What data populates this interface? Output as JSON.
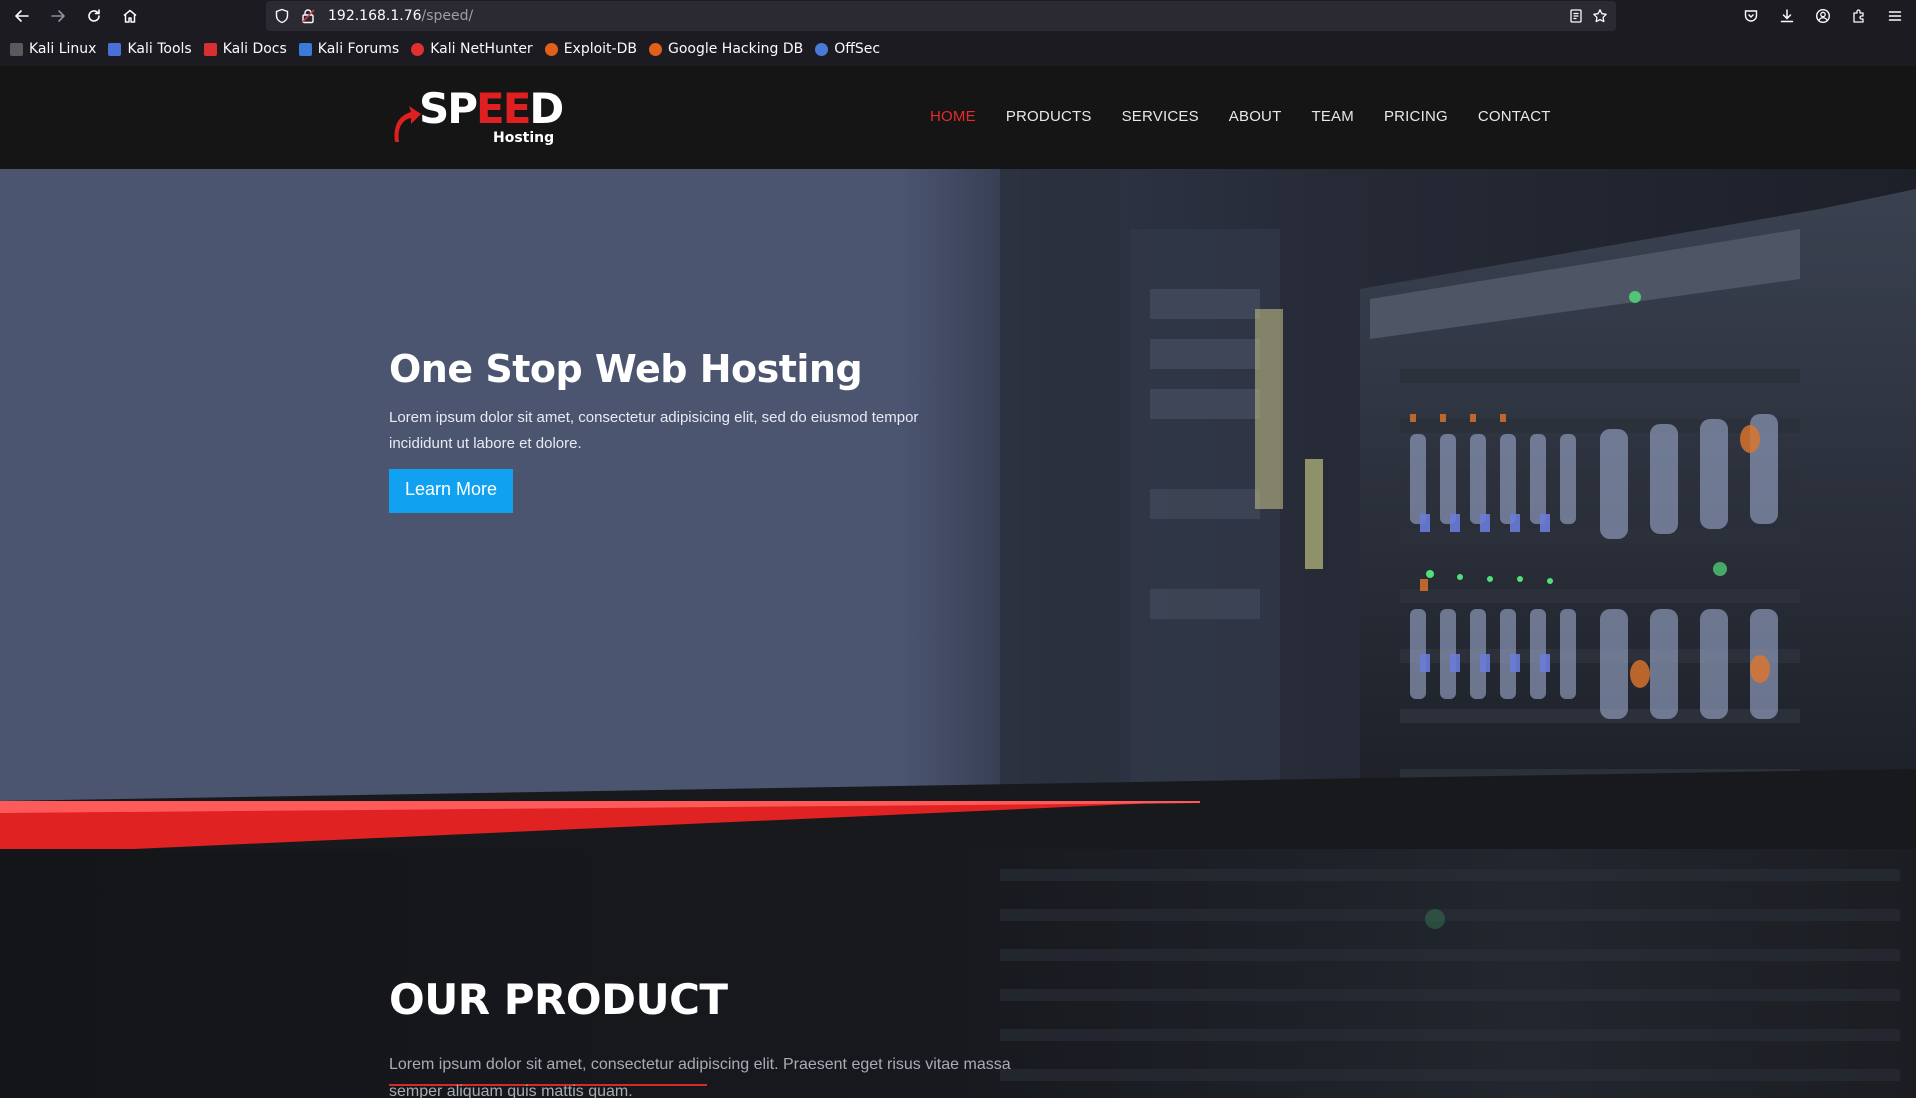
{
  "browser": {
    "url_host": "192.168.1.76",
    "url_path": "/speed/",
    "bookmarks": [
      {
        "label": "Kali Linux",
        "icon": "kali-linux-icon",
        "color": "#6e6e6e"
      },
      {
        "label": "Kali Tools",
        "icon": "kali-tools-icon",
        "color": "#4a6fd8"
      },
      {
        "label": "Kali Docs",
        "icon": "kali-docs-icon",
        "color": "#d83030"
      },
      {
        "label": "Kali Forums",
        "icon": "kali-forums-icon",
        "color": "#3a7ad8"
      },
      {
        "label": "Kali NetHunter",
        "icon": "kali-nethunter-icon",
        "color": "#e03030"
      },
      {
        "label": "Exploit-DB",
        "icon": "exploit-db-icon",
        "color": "#e0601a"
      },
      {
        "label": "Google Hacking DB",
        "icon": "google-hacking-db-icon",
        "color": "#e0601a"
      },
      {
        "label": "OffSec",
        "icon": "offsec-icon",
        "color": "#4a7ad8"
      }
    ]
  },
  "site": {
    "logo": {
      "text_white": "SP",
      "text_red": "EE",
      "text_white2": "D",
      "sub": "Hosting"
    },
    "nav": [
      {
        "label": "HOME",
        "active": true
      },
      {
        "label": "PRODUCTS",
        "active": false
      },
      {
        "label": "SERVICES",
        "active": false
      },
      {
        "label": "ABOUT",
        "active": false
      },
      {
        "label": "TEAM",
        "active": false
      },
      {
        "label": "PRICING",
        "active": false
      },
      {
        "label": "CONTACT",
        "active": false
      }
    ],
    "hero": {
      "title": "One Stop Web Hosting",
      "text": "Lorem ipsum dolor sit amet, consectetur adipisicing elit, sed do eiusmod tempor incididunt ut labore et dolore.",
      "button": "Learn More"
    },
    "product": {
      "title": "OUR PRODUCT",
      "text": "Lorem ipsum dolor sit amet, consectetur adipiscing elit. Praesent eget risus vitae massa semper aliquam quis mattis quam."
    },
    "colors": {
      "accent_red": "#e52b2b",
      "button_blue": "#10a2f0",
      "hero_overlay": "#4b5570",
      "header_bg": "#151515"
    }
  }
}
